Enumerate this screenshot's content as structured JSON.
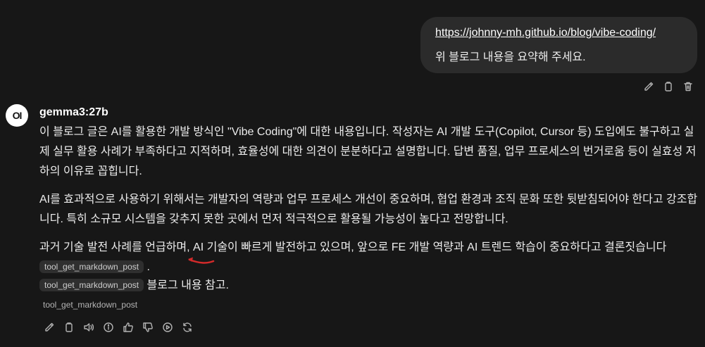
{
  "user_message": {
    "link": "https://johnny-mh.github.io/blog/vibe-coding/",
    "text": "위 블로그 내용을 요약해 주세요."
  },
  "user_actions": [
    "edit-icon",
    "copy-icon",
    "delete-icon"
  ],
  "assistant": {
    "avatar_text": "OI",
    "model": "gemma3:27b",
    "paragraph1": "이 블로그 글은 AI를 활용한 개발 방식인 \"Vibe Coding\"에 대한 내용입니다. 작성자는 AI 개발 도구(Copilot, Cursor 등) 도입에도 불구하고 실제 실무 활용 사례가 부족하다고 지적하며, 효율성에 대한 의견이 분분하다고 설명합니다. 답변 품질, 업무 프로세스의 번거로움 등이 실효성 저하의 이유로 꼽힙니다.",
    "paragraph2": "AI를 효과적으로 사용하기 위해서는 개발자의 역량과 업무 프로세스 개선이 중요하며, 협업 환경과 조직 문화 또한 뒷받침되어야 한다고 강조합니다. 특히 소규모 시스템을 갖추지 못한 곳에서 먼저 적극적으로 활용될 가능성이 높다고 전망합니다.",
    "paragraph3": "과거 기술 발전 사례를 언급하며, AI 기술이 빠르게 발전하고 있으며, 앞으로 FE 개발 역량과 AI 트렌드 학습이 중요하다고 결론짓습니다",
    "paragraph3_end": ".",
    "citation_chip": "tool_get_markdown_post",
    "ref_chip": "tool_get_markdown_post",
    "ref_text": "블로그 내용 참고.",
    "source_label": "tool_get_markdown_post"
  },
  "message_actions": [
    "edit-icon",
    "copy-icon",
    "read-aloud-icon",
    "info-icon",
    "thumbs-up-icon",
    "thumbs-down-icon",
    "continue-icon",
    "regenerate-icon"
  ],
  "colors": {
    "background": "#171717",
    "bubble": "#2b2b2b",
    "chip": "#2f2f2f",
    "annotation_arrow": "#d42a2a"
  }
}
